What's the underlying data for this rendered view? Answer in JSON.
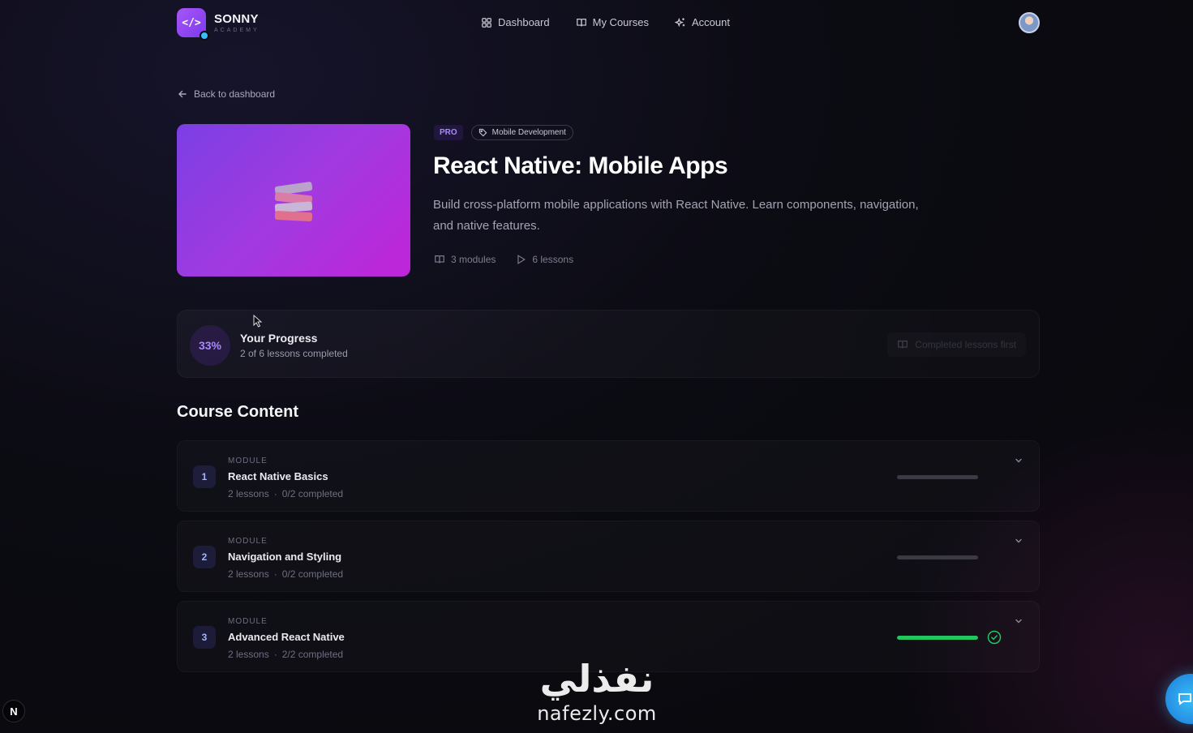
{
  "brand": {
    "name": "SONNY",
    "sub": "ACADEMY",
    "logo_glyph": "</>"
  },
  "nav": {
    "items": [
      {
        "label": "Dashboard",
        "icon": "grid-icon"
      },
      {
        "label": "My Courses",
        "icon": "book-icon"
      },
      {
        "label": "Account",
        "icon": "sparkle-icon"
      }
    ]
  },
  "back_link": "Back to dashboard",
  "course": {
    "tier": "PRO",
    "category": "Mobile Development",
    "title": "React Native: Mobile Apps",
    "description": "Build cross-platform mobile applications with React Native. Learn components, navigation, and native features.",
    "modules_count": "3 modules",
    "lessons_count": "6 lessons"
  },
  "progress": {
    "percent_label": "33%",
    "percent": 33,
    "title": "Your Progress",
    "subtitle": "2 of 6 lessons completed",
    "action_label": "Completed lessons first"
  },
  "section_title": "Course Content",
  "modules": [
    {
      "eyebrow": "MODULE",
      "number": "1",
      "title": "React Native Basics",
      "lessons": "2 lessons",
      "completed": "0/2 completed",
      "fraction": 0,
      "done": false
    },
    {
      "eyebrow": "MODULE",
      "number": "2",
      "title": "Navigation and Styling",
      "lessons": "2 lessons",
      "completed": "0/2 completed",
      "fraction": 0,
      "done": false
    },
    {
      "eyebrow": "MODULE",
      "number": "3",
      "title": "Advanced React Native",
      "lessons": "2 lessons",
      "completed": "2/2 completed",
      "fraction": 1,
      "done": true
    }
  ],
  "watermark": {
    "arabic": "نفذلي",
    "latin": "nafezly.com"
  },
  "colors": {
    "accent": "#7c3aed",
    "success": "#22c55e",
    "chat": "#38bdf8"
  }
}
